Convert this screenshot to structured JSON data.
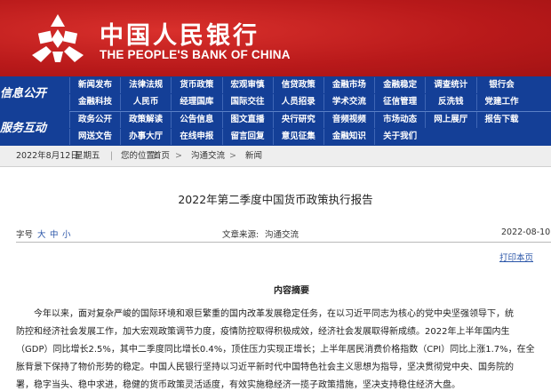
{
  "brand": {
    "name_cn": "中国人民银行",
    "name_en": "THE PEOPLE'S BANK OF CHINA",
    "colors": {
      "banner": "#c41a1d",
      "nav": "#143f97"
    }
  },
  "nav": {
    "sections": [
      "信息公开",
      "服务互动"
    ],
    "rows": [
      [
        "新闻发布",
        "法律法规",
        "货币政策",
        "宏观审慎",
        "信贷政策",
        "金融市场",
        "金融稳定",
        "调查统计",
        "银行会"
      ],
      [
        "金融科技",
        "人民币",
        "经理国库",
        "国际交往",
        "人员招录",
        "学术交流",
        "征信管理",
        "反洗钱",
        "党建工作"
      ],
      [
        "政务公开",
        "政策解读",
        "公告信息",
        "图文直播",
        "央行研究",
        "音频视频",
        "市场动态",
        "网上展厅",
        "报告下载"
      ],
      [
        "网送文告",
        "办事大厅",
        "在线申报",
        "留言回复",
        "意见征集",
        "金融知识",
        "关于我们"
      ]
    ]
  },
  "breadcrumb": {
    "date": "2022年8月12日",
    "weekday": "星期五",
    "divider": "|",
    "location_label": "您的位置:",
    "home": "首页",
    "separator": ">",
    "items": [
      "沟通交流",
      "新闻"
    ]
  },
  "article": {
    "title": "2022年第二季度中国货币政策执行报告",
    "font_size_label": "字号",
    "font_sizes": [
      "大",
      "中",
      "小"
    ],
    "source_label": "文章来源:",
    "source": "沟通交流",
    "date": "2022-08-10",
    "print_label": "打印本页",
    "section_heading": "内容摘要",
    "paragraph_lines": [
      "今年以来，面对复杂严峻的国际环境和艰巨繁重的国内改革发展稳定任务，在以习近平同志为核心的党中央坚强领导下，统",
      "防控和经济社会发展工作，加大宏观政策调节力度，疫情防控取得积极成效，经济社会发展取得新成绩。2022年上半年国内生",
      "（GDP）同比增长2.5%，其中二季度同比增长0.4%，顶住压力实现正增长；上半年居民消费价格指数（CPI）同比上涨1.7%，在全",
      "胀背景下保持了物价形势的稳定。中国人民银行坚持以习近平新时代中国特色社会主义思想为指导，坚决贯彻党中央、国务院的",
      "署，稳字当头、稳中求进，稳健的货币政策灵活适度，有效实施稳经济一揽子政策措施，坚决支持稳住经济大盘。"
    ]
  }
}
